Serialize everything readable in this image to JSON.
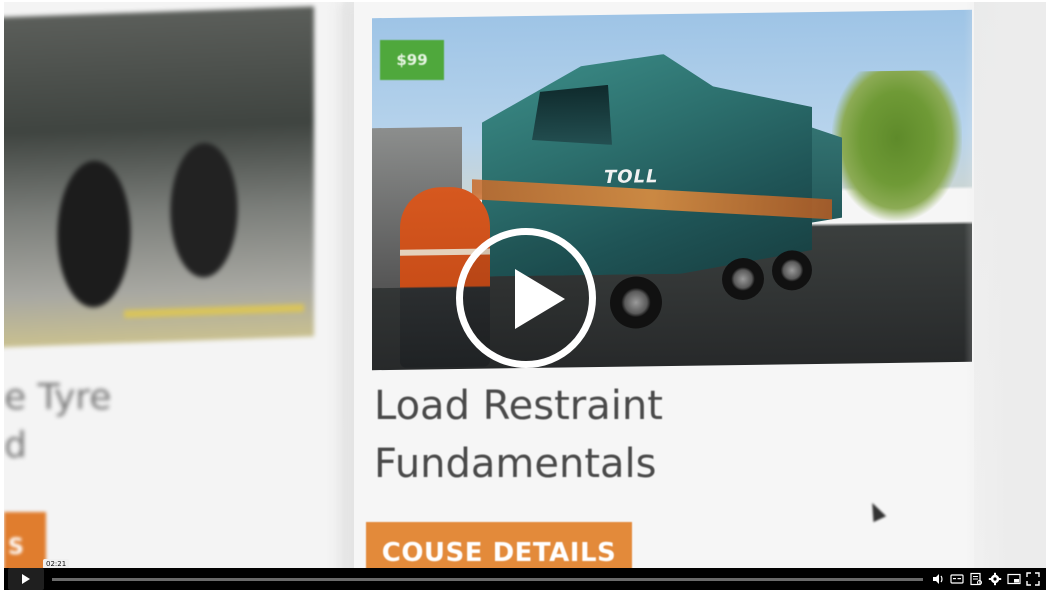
{
  "video": {
    "price_badge": "$99",
    "logo_text": "TOLL",
    "left_card_text_line1": "e Tyre",
    "left_card_text_line2": "d",
    "left_card_button": "S",
    "course_title_line1": "Load Restraint",
    "course_title_line2": "Fundamentals",
    "details_button": "COUSE DETAILS"
  },
  "player": {
    "current_time": "02:21",
    "progress": 0.0,
    "icons": [
      "play-icon",
      "volume-icon",
      "captions-icon",
      "transcript-icon",
      "settings-icon",
      "picture-in-picture-icon",
      "fullscreen-icon"
    ]
  },
  "colors": {
    "orange_button": "#e38a3a",
    "green_badge": "#4fa83c",
    "control_bar": "#000000"
  }
}
